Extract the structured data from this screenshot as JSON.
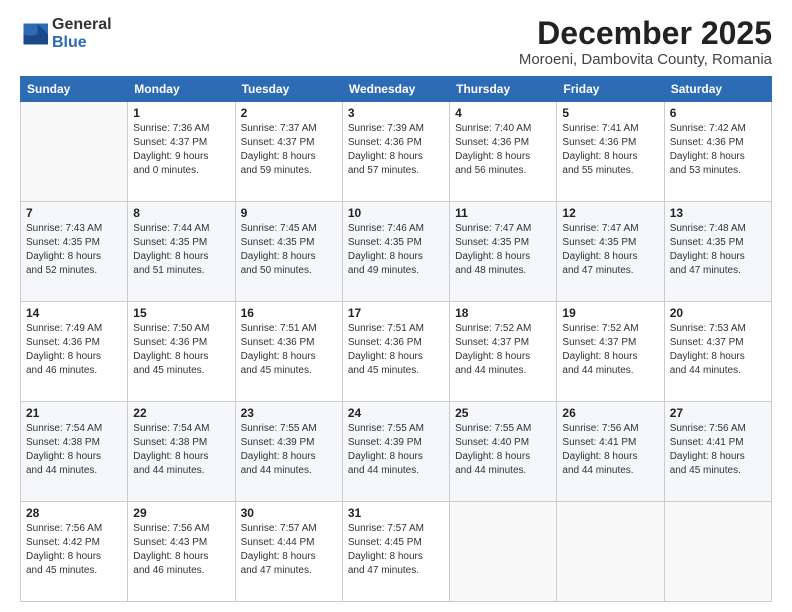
{
  "header": {
    "logo_general": "General",
    "logo_blue": "Blue",
    "month": "December 2025",
    "location": "Moroeni, Dambovita County, Romania"
  },
  "weekdays": [
    "Sunday",
    "Monday",
    "Tuesday",
    "Wednesday",
    "Thursday",
    "Friday",
    "Saturday"
  ],
  "weeks": [
    [
      {
        "day": "",
        "info": ""
      },
      {
        "day": "1",
        "info": "Sunrise: 7:36 AM\nSunset: 4:37 PM\nDaylight: 9 hours\nand 0 minutes."
      },
      {
        "day": "2",
        "info": "Sunrise: 7:37 AM\nSunset: 4:37 PM\nDaylight: 8 hours\nand 59 minutes."
      },
      {
        "day": "3",
        "info": "Sunrise: 7:39 AM\nSunset: 4:36 PM\nDaylight: 8 hours\nand 57 minutes."
      },
      {
        "day": "4",
        "info": "Sunrise: 7:40 AM\nSunset: 4:36 PM\nDaylight: 8 hours\nand 56 minutes."
      },
      {
        "day": "5",
        "info": "Sunrise: 7:41 AM\nSunset: 4:36 PM\nDaylight: 8 hours\nand 55 minutes."
      },
      {
        "day": "6",
        "info": "Sunrise: 7:42 AM\nSunset: 4:36 PM\nDaylight: 8 hours\nand 53 minutes."
      }
    ],
    [
      {
        "day": "7",
        "info": "Sunrise: 7:43 AM\nSunset: 4:35 PM\nDaylight: 8 hours\nand 52 minutes."
      },
      {
        "day": "8",
        "info": "Sunrise: 7:44 AM\nSunset: 4:35 PM\nDaylight: 8 hours\nand 51 minutes."
      },
      {
        "day": "9",
        "info": "Sunrise: 7:45 AM\nSunset: 4:35 PM\nDaylight: 8 hours\nand 50 minutes."
      },
      {
        "day": "10",
        "info": "Sunrise: 7:46 AM\nSunset: 4:35 PM\nDaylight: 8 hours\nand 49 minutes."
      },
      {
        "day": "11",
        "info": "Sunrise: 7:47 AM\nSunset: 4:35 PM\nDaylight: 8 hours\nand 48 minutes."
      },
      {
        "day": "12",
        "info": "Sunrise: 7:47 AM\nSunset: 4:35 PM\nDaylight: 8 hours\nand 47 minutes."
      },
      {
        "day": "13",
        "info": "Sunrise: 7:48 AM\nSunset: 4:35 PM\nDaylight: 8 hours\nand 47 minutes."
      }
    ],
    [
      {
        "day": "14",
        "info": "Sunrise: 7:49 AM\nSunset: 4:36 PM\nDaylight: 8 hours\nand 46 minutes."
      },
      {
        "day": "15",
        "info": "Sunrise: 7:50 AM\nSunset: 4:36 PM\nDaylight: 8 hours\nand 45 minutes."
      },
      {
        "day": "16",
        "info": "Sunrise: 7:51 AM\nSunset: 4:36 PM\nDaylight: 8 hours\nand 45 minutes."
      },
      {
        "day": "17",
        "info": "Sunrise: 7:51 AM\nSunset: 4:36 PM\nDaylight: 8 hours\nand 45 minutes."
      },
      {
        "day": "18",
        "info": "Sunrise: 7:52 AM\nSunset: 4:37 PM\nDaylight: 8 hours\nand 44 minutes."
      },
      {
        "day": "19",
        "info": "Sunrise: 7:52 AM\nSunset: 4:37 PM\nDaylight: 8 hours\nand 44 minutes."
      },
      {
        "day": "20",
        "info": "Sunrise: 7:53 AM\nSunset: 4:37 PM\nDaylight: 8 hours\nand 44 minutes."
      }
    ],
    [
      {
        "day": "21",
        "info": "Sunrise: 7:54 AM\nSunset: 4:38 PM\nDaylight: 8 hours\nand 44 minutes."
      },
      {
        "day": "22",
        "info": "Sunrise: 7:54 AM\nSunset: 4:38 PM\nDaylight: 8 hours\nand 44 minutes."
      },
      {
        "day": "23",
        "info": "Sunrise: 7:55 AM\nSunset: 4:39 PM\nDaylight: 8 hours\nand 44 minutes."
      },
      {
        "day": "24",
        "info": "Sunrise: 7:55 AM\nSunset: 4:39 PM\nDaylight: 8 hours\nand 44 minutes."
      },
      {
        "day": "25",
        "info": "Sunrise: 7:55 AM\nSunset: 4:40 PM\nDaylight: 8 hours\nand 44 minutes."
      },
      {
        "day": "26",
        "info": "Sunrise: 7:56 AM\nSunset: 4:41 PM\nDaylight: 8 hours\nand 44 minutes."
      },
      {
        "day": "27",
        "info": "Sunrise: 7:56 AM\nSunset: 4:41 PM\nDaylight: 8 hours\nand 45 minutes."
      }
    ],
    [
      {
        "day": "28",
        "info": "Sunrise: 7:56 AM\nSunset: 4:42 PM\nDaylight: 8 hours\nand 45 minutes."
      },
      {
        "day": "29",
        "info": "Sunrise: 7:56 AM\nSunset: 4:43 PM\nDaylight: 8 hours\nand 46 minutes."
      },
      {
        "day": "30",
        "info": "Sunrise: 7:57 AM\nSunset: 4:44 PM\nDaylight: 8 hours\nand 47 minutes."
      },
      {
        "day": "31",
        "info": "Sunrise: 7:57 AM\nSunset: 4:45 PM\nDaylight: 8 hours\nand 47 minutes."
      },
      {
        "day": "",
        "info": ""
      },
      {
        "day": "",
        "info": ""
      },
      {
        "day": "",
        "info": ""
      }
    ]
  ]
}
